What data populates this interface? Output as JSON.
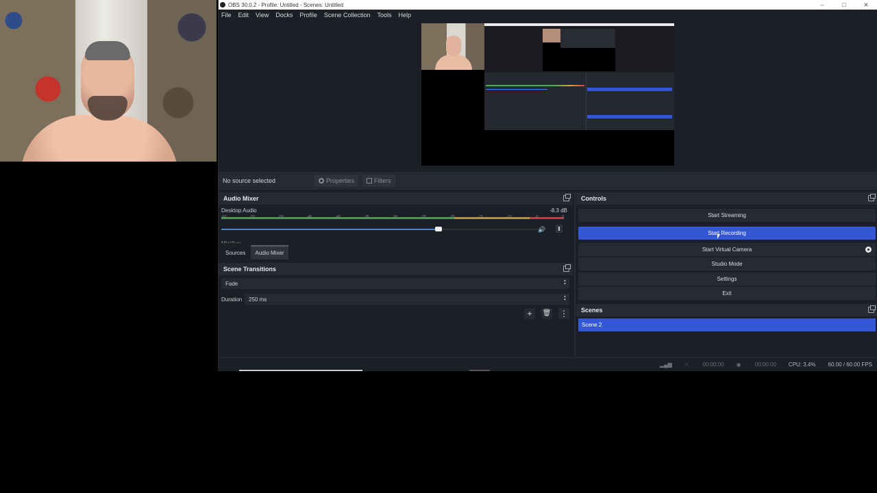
{
  "window": {
    "title": "OBS 30.0.2 - Profile: Untitled - Scenes: Untitled",
    "controls": [
      "–",
      "□",
      "✕"
    ]
  },
  "menu": [
    "File",
    "Edit",
    "View",
    "Docks",
    "Profile",
    "Scene Collection",
    "Tools",
    "Help"
  ],
  "source_bar": {
    "no_source": "No source selected",
    "properties": "Properties",
    "filters": "Filters"
  },
  "audio_mixer": {
    "title": "Audio Mixer",
    "channel_name": "Desktop Audio",
    "channel_db": "-8.3 dB",
    "ticks": [
      "-60",
      "-55",
      "-50",
      "-45",
      "-40",
      "-35",
      "-30",
      "-25",
      "-20",
      "-15",
      "-10",
      "-5",
      "0"
    ],
    "volume_level": 0.68,
    "second_channel": "Mic/Aux"
  },
  "tabs": [
    "Sources",
    "Audio Mixer"
  ],
  "scene_transitions": {
    "title": "Scene Transitions",
    "transition": "Fade",
    "duration_label": "Duration",
    "duration_value": "250 ms"
  },
  "controls": {
    "title": "Controls",
    "buttons": [
      "Start Streaming",
      "Start Recording",
      "Start Virtual Camera",
      "Studio Mode",
      "Settings",
      "Exit"
    ]
  },
  "scenes": {
    "title": "Scenes",
    "items": [
      "Scene 2"
    ]
  },
  "status": {
    "stream_time": "00:00:00",
    "rec_time": "00:00:00",
    "cpu": "CPU: 3.4%",
    "fps": "60.00 / 60.00 FPS"
  },
  "colors": {
    "accent": "#3458d4",
    "background": "#1d1f26",
    "panel": "#272a33"
  }
}
